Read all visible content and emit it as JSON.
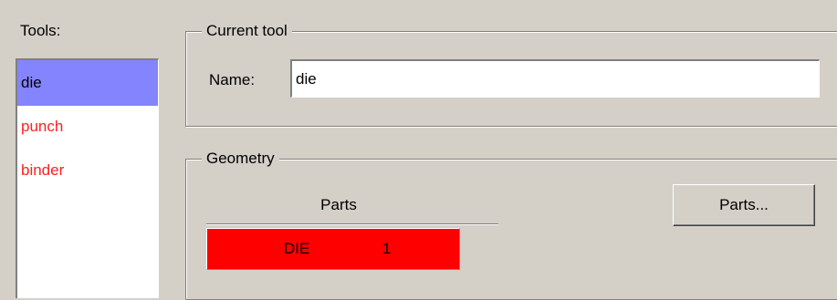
{
  "tools": {
    "label": "Tools:",
    "items": [
      {
        "label": "die",
        "selected": true,
        "color": "#000000"
      },
      {
        "label": "punch",
        "selected": false,
        "color": "#ff2020"
      },
      {
        "label": "binder",
        "selected": false,
        "color": "#ff2020"
      }
    ],
    "selected_bg": "#8484ff"
  },
  "current_tool": {
    "title": "Current tool",
    "name_label": "Name:",
    "name_value": "die"
  },
  "geometry": {
    "title": "Geometry",
    "parts_header": "Parts",
    "parts": [
      {
        "name": "DIE",
        "count": "1",
        "color": "#ff0000"
      }
    ],
    "parts_button": "Parts..."
  }
}
